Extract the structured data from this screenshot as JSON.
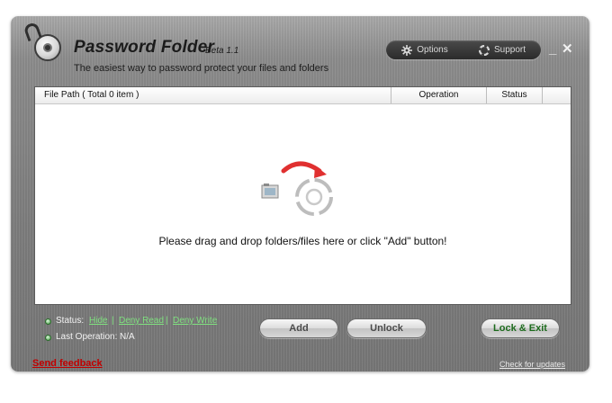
{
  "app": {
    "title": "Password Folder",
    "version": "Beta 1.1",
    "subtitle": "The easiest way to password protect your files and folders"
  },
  "top_buttons": {
    "options_label": "Options",
    "support_label": "Support",
    "options_icon": "gear-icon",
    "support_icon": "lifebuoy-icon"
  },
  "window_controls": {
    "minimize_glyph": "_",
    "close_glyph": "✕"
  },
  "table": {
    "columns": [
      "File Path  ( Total 0 item )",
      "Operation",
      "Status"
    ]
  },
  "drop_area": {
    "message": "Please drag and drop folders/files here or click \"Add\" button!"
  },
  "status": {
    "label": "Status:",
    "options": [
      "Hide",
      "Deny Read",
      "Deny Write"
    ],
    "separator": "|",
    "last_operation_label": "Last Operation:",
    "last_operation_value": "N/A"
  },
  "buttons": {
    "add_label": "Add",
    "unlock_label": "Unlock",
    "lock_exit_label": "Lock & Exit"
  },
  "footer": {
    "feedback_label": "Send feedback",
    "updates_label": "Check for updates"
  },
  "colors": {
    "accent_green": "#7fe07f",
    "feedback_red": "#c00000",
    "arrow_red": "#e03030"
  }
}
